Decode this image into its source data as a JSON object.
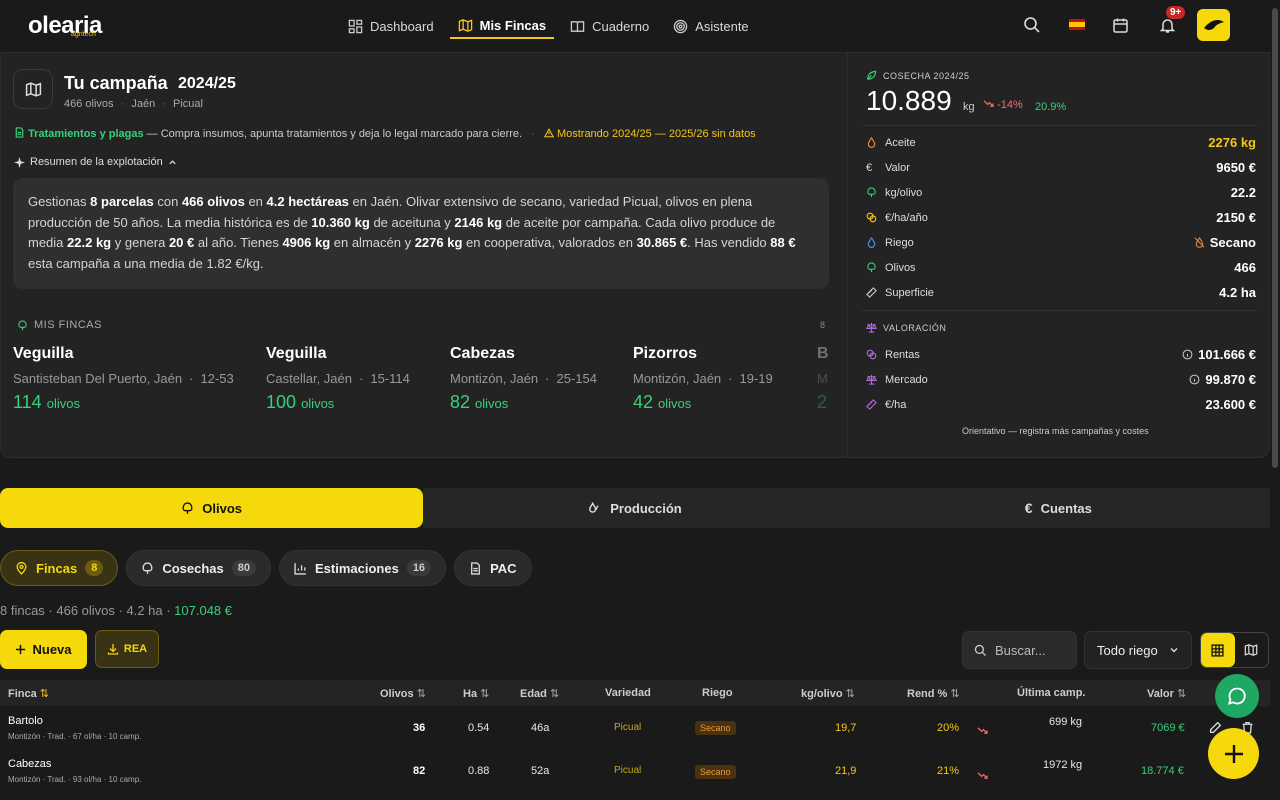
{
  "brand": {
    "name": "olearia",
    "tagline": "agritech"
  },
  "nav": [
    {
      "label": "Dashboard",
      "icon": "dashboard-icon",
      "active": false
    },
    {
      "label": "Mis Fincas",
      "icon": "map-icon",
      "active": true
    },
    {
      "label": "Cuaderno",
      "icon": "book-icon",
      "active": false
    },
    {
      "label": "Asistente",
      "icon": "target-icon",
      "active": false
    }
  ],
  "notifications": {
    "badge": "9+"
  },
  "campaign": {
    "title": "Tu campaña",
    "year": "2024/25",
    "sub_olivos": "466 olivos",
    "sub_region": "Jaén",
    "sub_variety": "Picual",
    "trat_label": "Tratamientos y plagas",
    "trat_text": "— Compra insumos, apunta tratamientos y deja lo legal marcado para cierre.",
    "dot": "·",
    "warning": "Mostrando 2024/25 — 2025/26 sin datos",
    "resumen_label": "Resumen de la explotación"
  },
  "resumen": {
    "t1": "Gestionas ",
    "b1": "8 parcelas",
    "t2": " con ",
    "b2": "466 olivos",
    "t3": " en ",
    "b3": "4.2 hectáreas",
    "t4": " en Jaén. Olivar extensivo de secano, variedad Picual, olivos en plena producción de 50 años. La media histórica es de ",
    "b4": "10.360 kg",
    "t5": " de aceituna y ",
    "b5": "2146 kg",
    "t6": " de aceite por campaña. Cada olivo produce de media ",
    "b6": "22.2 kg",
    "t7": " y genera ",
    "b7": "20 €",
    "t8": " al año. Tienes ",
    "b8": "4906 kg",
    "t9": " en almacén y ",
    "b9": "2276 kg",
    "t10": " en cooperativa, valorados en ",
    "b10": "30.865 €",
    "t11": ". Has vendido ",
    "b11": "88 €",
    "t12": " esta campaña a una media de 1.82 €/kg."
  },
  "mis_fincas": {
    "title": "MIS FINCAS",
    "count": "8",
    "unit": "olivos",
    "cards": [
      {
        "name": "Veguilla",
        "loc": "Santisteban Del Puerto, Jaén",
        "code": "12-53",
        "olivos": "114"
      },
      {
        "name": "Veguilla",
        "loc": "Castellar, Jaén",
        "code": "15-114",
        "olivos": "100"
      },
      {
        "name": "Cabezas",
        "loc": "Montizón, Jaén",
        "code": "25-154",
        "olivos": "82"
      },
      {
        "name": "Pizorros",
        "loc": "Montizón, Jaén",
        "code": "19-19",
        "olivos": "42"
      },
      {
        "name": "B",
        "loc": "M",
        "code": "",
        "olivos": "2"
      }
    ]
  },
  "cosecha": {
    "title": "COSECHA 2024/25",
    "value": "10.889",
    "unit": "kg",
    "delta": "-14%",
    "pct": "20.9%",
    "rows": [
      {
        "label": "Aceite",
        "value": "2276 kg",
        "icon": "drop-icon",
        "color": "#f5c518"
      },
      {
        "label": "Valor",
        "value": "9650 €",
        "icon": "euro-icon",
        "color": "#ffffff"
      },
      {
        "label": "kg/olivo",
        "value": "22.2",
        "icon": "tree-icon",
        "color": "#ffffff"
      },
      {
        "label": "€/ha/año",
        "value": "2150 €",
        "icon": "coins-icon",
        "color": "#ffffff"
      },
      {
        "label": "Riego",
        "value": "Secano",
        "icon": "water-icon",
        "color": "#ffffff"
      },
      {
        "label": "Olivos",
        "value": "466",
        "icon": "tree-icon",
        "color": "#ffffff"
      },
      {
        "label": "Superficie",
        "value": "4.2 ha",
        "icon": "ruler-icon",
        "color": "#ffffff"
      }
    ]
  },
  "valoracion": {
    "title": "VALORACIÓN",
    "rows": [
      {
        "label": "Rentas",
        "value": "101.666 €",
        "info": true
      },
      {
        "label": "Mercado",
        "value": "99.870 €",
        "info": true
      },
      {
        "label": "€/ha",
        "value": "23.600 €",
        "info": false
      }
    ],
    "note": "Orientativo — registra más campañas y costes"
  },
  "main_tabs": [
    {
      "label": "Olivos",
      "active": true
    },
    {
      "label": "Producción",
      "active": false
    },
    {
      "label": "Cuentas",
      "active": false
    }
  ],
  "sub_tabs": [
    {
      "label": "Fincas",
      "count": "8",
      "active": true
    },
    {
      "label": "Cosechas",
      "count": "80",
      "active": false
    },
    {
      "label": "Estimaciones",
      "count": "16",
      "active": false
    },
    {
      "label": "PAC",
      "count": "",
      "active": false
    }
  ],
  "summary": {
    "text": "8 fincas · 466 olivos · 4.2 ha · ",
    "value": "107.048 €"
  },
  "actions": {
    "nueva": "Nueva",
    "rea": "REA",
    "search_placeholder": "Buscar...",
    "riego_filter": "Todo riego"
  },
  "table": {
    "headers": [
      "Finca",
      "Olivos",
      "Ha",
      "Edad",
      "Variedad",
      "Riego",
      "kg/olivo",
      "Rend %",
      "Última camp.",
      "Valor"
    ],
    "rows": [
      {
        "name": "Bartolo",
        "sub": "Montizón · Trad. · 67 ol/ha · 10 camp.",
        "olivos": "36",
        "ha": "0.54",
        "edad": "46a",
        "variedad": "Picual",
        "riego": "Secano",
        "kgolivo": "19,7",
        "rend": "20%",
        "ultima": "699 kg",
        "valor": "7069 €"
      },
      {
        "name": "Cabezas",
        "sub": "Montizón · Trad. · 93 ol/ha · 10 camp.",
        "olivos": "82",
        "ha": "0.88",
        "edad": "52a",
        "variedad": "Picual",
        "riego": "Secano",
        "kgolivo": "21,9",
        "rend": "21%",
        "ultima": "1972 kg",
        "valor": "18.774 €"
      }
    ]
  }
}
